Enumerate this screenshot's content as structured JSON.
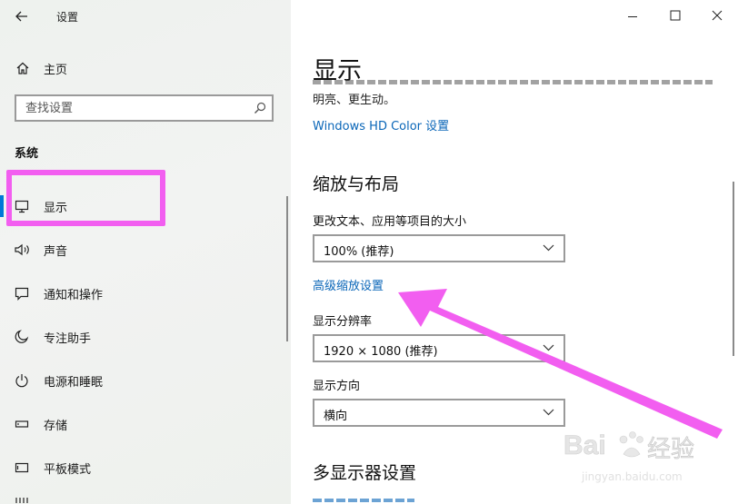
{
  "window": {
    "title": "设置",
    "controls": {
      "minimize": "minimize",
      "maximize": "maximize",
      "close": "close"
    }
  },
  "sidebar": {
    "home_label": "主页",
    "search_placeholder": "查找设置",
    "section_title": "系统",
    "items": [
      {
        "label": "显示",
        "icon": "monitor-icon",
        "selected": true
      },
      {
        "label": "声音",
        "icon": "speaker-icon"
      },
      {
        "label": "通知和操作",
        "icon": "notification-icon"
      },
      {
        "label": "专注助手",
        "icon": "moon-icon"
      },
      {
        "label": "电源和睡眠",
        "icon": "power-icon"
      },
      {
        "label": "存储",
        "icon": "storage-icon"
      },
      {
        "label": "平板模式",
        "icon": "tablet-icon"
      }
    ]
  },
  "main": {
    "page_title": "显示",
    "truncated_text": "明亮、更生动。",
    "hdr_link": "Windows HD Color 设置",
    "scale_section": {
      "title": "缩放与布局",
      "text_size_label": "更改文本、应用等项目的大小",
      "text_size_value": "100% (推荐)",
      "advanced_link": "高级缩放设置",
      "resolution_label": "显示分辨率",
      "resolution_value": "1920 × 1080 (推荐)",
      "orientation_label": "显示方向",
      "orientation_value": "横向"
    },
    "multi_section": {
      "title": "多显示器设置"
    }
  },
  "annotations": {
    "highlight_color": "#f25ef0",
    "arrow_color": "#f25ef0"
  },
  "watermark": {
    "text": "Bai 经验",
    "subtext": "jingyan.baidu.com"
  },
  "colors": {
    "accent": "#0078d7",
    "link": "#0a66b8"
  }
}
